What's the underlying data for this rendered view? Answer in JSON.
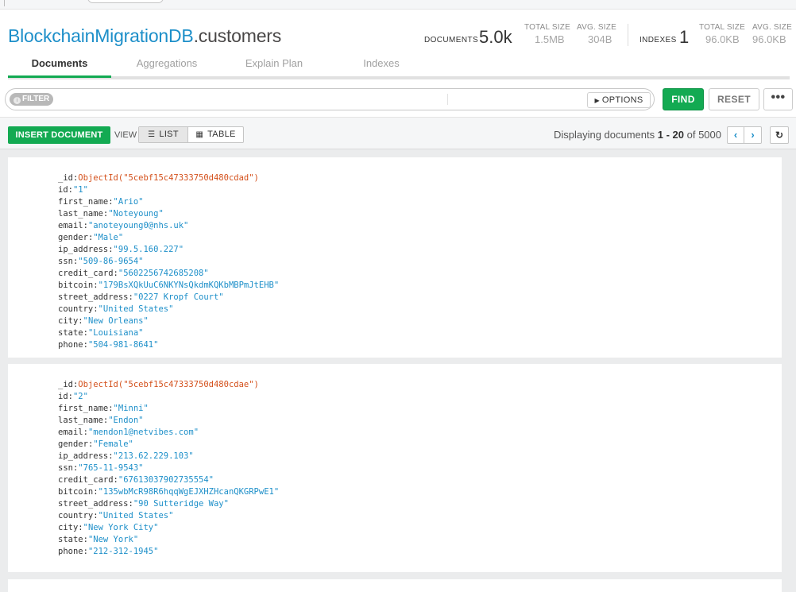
{
  "header": {
    "db_name": "BlockchainMigrationDB",
    "collection_name": ".customers",
    "documents_label": "DOCUMENTS",
    "documents_count": "5.0k",
    "doc_total_size_label": "TOTAL SIZE",
    "doc_total_size": "1.5MB",
    "doc_avg_size_label": "AVG. SIZE",
    "doc_avg_size": "304B",
    "indexes_label": "INDEXES",
    "indexes_count": "1",
    "idx_total_size_label": "TOTAL SIZE",
    "idx_total_size": "96.0KB",
    "idx_avg_size_label": "AVG. SIZE",
    "idx_avg_size": "96.0KB"
  },
  "tabs": [
    {
      "label": "Documents"
    },
    {
      "label": "Aggregations"
    },
    {
      "label": "Explain Plan"
    },
    {
      "label": "Indexes"
    }
  ],
  "query": {
    "filter_label": "FILTER",
    "options_label": "OPTIONS",
    "find_label": "FIND",
    "reset_label": "RESET",
    "more_label": "•••"
  },
  "toolbar": {
    "insert_label": "INSERT DOCUMENT",
    "view_label": "VIEW",
    "list_label": "LIST",
    "table_label": "TABLE",
    "paging_prefix": "Displaying documents ",
    "paging_range": "1 - 20",
    "paging_of": " of ",
    "paging_total": "5000"
  },
  "documents": [
    {
      "fields": [
        {
          "key": "_id",
          "value": "ObjectId(\"5cebf15c47333750d480cdad\")",
          "type": "oid"
        },
        {
          "key": "id",
          "value": "\"1\""
        },
        {
          "key": "first_name",
          "value": "\"Ario\""
        },
        {
          "key": "last_name",
          "value": "\"Noteyoung\""
        },
        {
          "key": "email",
          "value": "\"anoteyoung0@nhs.uk\""
        },
        {
          "key": "gender",
          "value": "\"Male\""
        },
        {
          "key": "ip_address",
          "value": "\"99.5.160.227\""
        },
        {
          "key": "ssn",
          "value": "\"509-86-9654\""
        },
        {
          "key": "credit_card",
          "value": "\"5602256742685208\""
        },
        {
          "key": "bitcoin",
          "value": "\"179BsXQkUuC6NKYNsQkdmKQKbMBPmJtEHB\""
        },
        {
          "key": "street_address",
          "value": "\"0227 Kropf Court\""
        },
        {
          "key": "country",
          "value": "\"United States\""
        },
        {
          "key": "city",
          "value": "\"New Orleans\""
        },
        {
          "key": "state",
          "value": "\"Louisiana\""
        },
        {
          "key": "phone",
          "value": "\"504-981-8641\""
        }
      ]
    },
    {
      "fields": [
        {
          "key": "_id",
          "value": "ObjectId(\"5cebf15c47333750d480cdae\")",
          "type": "oid"
        },
        {
          "key": "id",
          "value": "\"2\""
        },
        {
          "key": "first_name",
          "value": "\"Minni\""
        },
        {
          "key": "last_name",
          "value": "\"Endon\""
        },
        {
          "key": "email",
          "value": "\"mendon1@netvibes.com\""
        },
        {
          "key": "gender",
          "value": "\"Female\""
        },
        {
          "key": "ip_address",
          "value": "\"213.62.229.103\""
        },
        {
          "key": "ssn",
          "value": "\"765-11-9543\""
        },
        {
          "key": "credit_card",
          "value": "\"67613037902735554\""
        },
        {
          "key": "bitcoin",
          "value": "\"135wbMcR98R6hqqWgEJXHZHcanQKGRPwE1\""
        },
        {
          "key": "street_address",
          "value": "\"90 Sutteridge Way\""
        },
        {
          "key": "country",
          "value": "\"United States\""
        },
        {
          "key": "city",
          "value": "\"New York City\""
        },
        {
          "key": "state",
          "value": "\"New York\""
        },
        {
          "key": "phone",
          "value": "\"212-312-1945\""
        }
      ]
    }
  ]
}
